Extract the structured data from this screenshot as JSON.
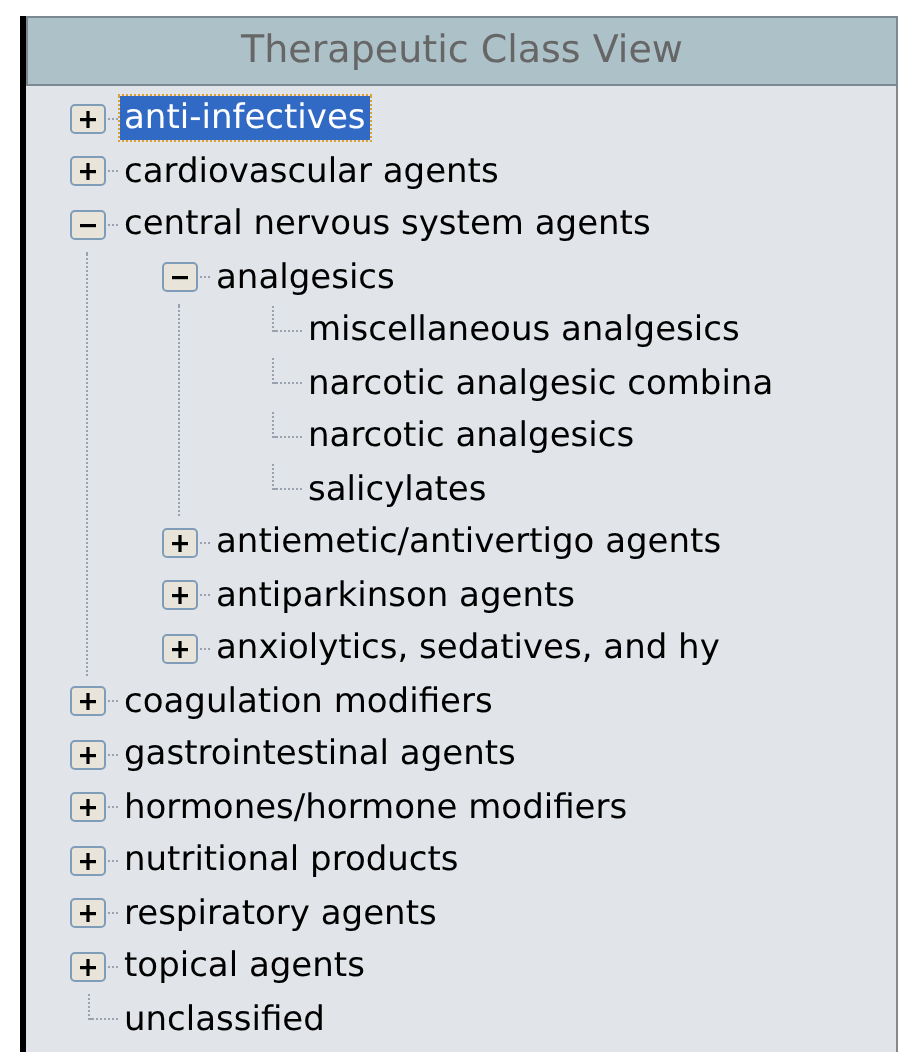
{
  "panel": {
    "title": "Therapeutic Class View"
  },
  "tree": [
    {
      "label": "anti-infectives",
      "expanded": false,
      "selected": true
    },
    {
      "label": "cardiovascular agents",
      "expanded": false,
      "selected": false
    },
    {
      "label": "central nervous system agents",
      "expanded": true,
      "selected": false,
      "children": [
        {
          "label": "analgesics",
          "expanded": true,
          "selected": false,
          "children": [
            {
              "label": "miscellaneous analgesics",
              "selected": false
            },
            {
              "label": "narcotic analgesic combina",
              "selected": false
            },
            {
              "label": "narcotic analgesics",
              "selected": false
            },
            {
              "label": "salicylates",
              "selected": false
            }
          ]
        },
        {
          "label": "antiemetic/antivertigo agents",
          "expanded": false,
          "selected": false
        },
        {
          "label": "antiparkinson agents",
          "expanded": false,
          "selected": false
        },
        {
          "label": "anxiolytics, sedatives, and hy",
          "expanded": false,
          "selected": false
        }
      ]
    },
    {
      "label": "coagulation modifiers",
      "expanded": false,
      "selected": false
    },
    {
      "label": "gastrointestinal agents",
      "expanded": false,
      "selected": false
    },
    {
      "label": "hormones/hormone modifiers",
      "expanded": false,
      "selected": false
    },
    {
      "label": "nutritional products",
      "expanded": false,
      "selected": false
    },
    {
      "label": "respiratory agents",
      "expanded": false,
      "selected": false
    },
    {
      "label": "topical agents",
      "expanded": false,
      "selected": false
    },
    {
      "label": "unclassified",
      "selected": false
    }
  ]
}
